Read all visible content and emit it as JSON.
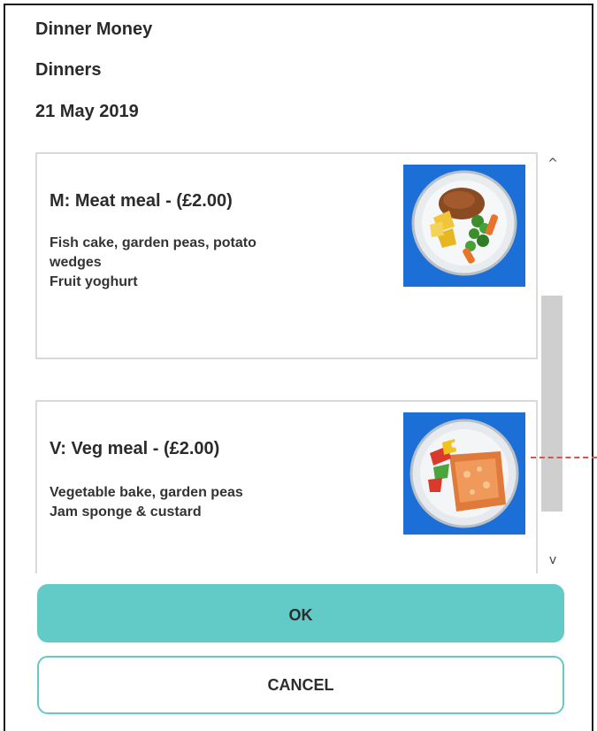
{
  "header": {
    "category": "Dinner Money",
    "subcategory": "Dinners",
    "date": "21 May 2019"
  },
  "meals": [
    {
      "title": "M: Meat meal - (£2.00)",
      "description_lines": [
        "Fish cake, garden peas, potato",
        "wedges",
        "Fruit yoghurt"
      ],
      "image_icon": "meat-meal-plate-icon"
    },
    {
      "title": "V: Veg meal - (£2.00)",
      "description_lines": [
        "Vegetable bake, garden peas",
        "Jam sponge & custard"
      ],
      "image_icon": "veg-meal-plate-icon"
    }
  ],
  "scrollbar": {
    "up_glyph": "^",
    "down_glyph": "v"
  },
  "actions": {
    "ok_label": "OK",
    "cancel_label": "CANCEL"
  },
  "colors": {
    "accent": "#63cbc7",
    "image_background": "#1b6fd6",
    "pointer": "#d9534f"
  }
}
